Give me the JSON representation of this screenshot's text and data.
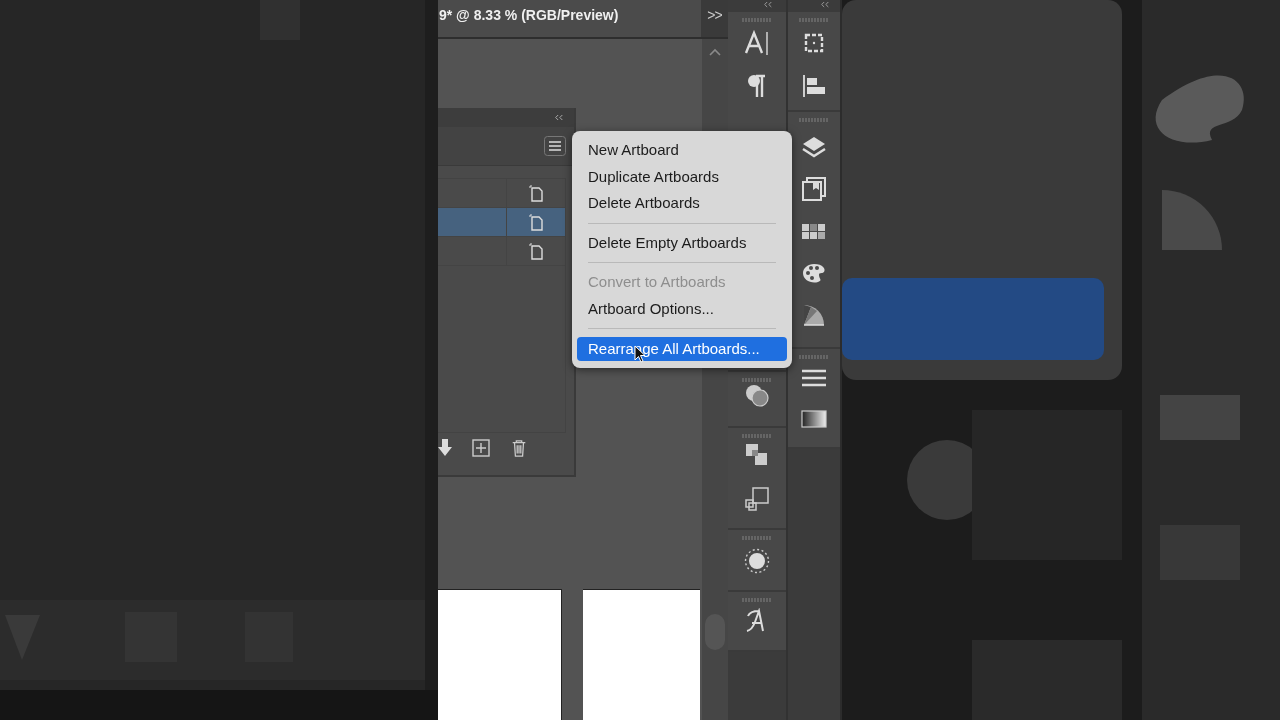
{
  "document_tab": {
    "title": "9* @ 8.33 % (RGB/Preview)",
    "overflow": ">>"
  },
  "artboards_panel": {
    "rows": [
      {
        "selected": false
      },
      {
        "selected": true
      },
      {
        "selected": false
      }
    ]
  },
  "context_menu": {
    "items": [
      {
        "kind": "item",
        "label": "New Artboard",
        "disabled": false,
        "selected": false
      },
      {
        "kind": "item",
        "label": "Duplicate Artboards",
        "disabled": false,
        "selected": false
      },
      {
        "kind": "item",
        "label": "Delete Artboards",
        "disabled": false,
        "selected": false
      },
      {
        "kind": "separator"
      },
      {
        "kind": "item",
        "label": "Delete Empty Artboards",
        "disabled": false,
        "selected": false
      },
      {
        "kind": "separator"
      },
      {
        "kind": "item",
        "label": "Convert to Artboards",
        "disabled": true,
        "selected": false
      },
      {
        "kind": "item",
        "label": "Artboard Options...",
        "disabled": false,
        "selected": false
      },
      {
        "kind": "separator"
      },
      {
        "kind": "item",
        "label": "Rearrange All Artboards...",
        "disabled": false,
        "selected": true
      }
    ]
  }
}
